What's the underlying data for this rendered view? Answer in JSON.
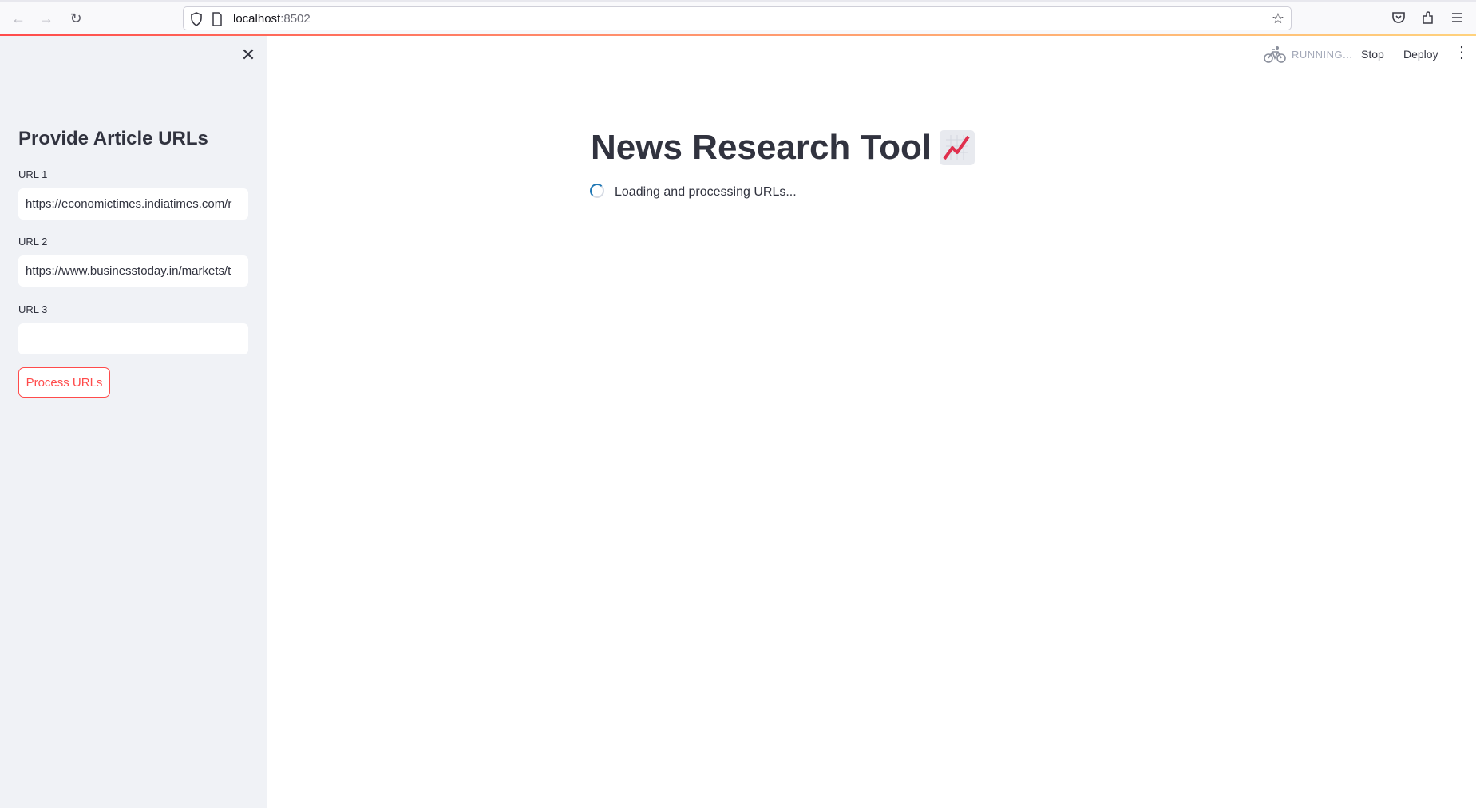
{
  "browser": {
    "url_host": "localhost",
    "url_port": ":8502"
  },
  "sidebar": {
    "title": "Provide Article URLs",
    "fields": [
      {
        "label": "URL 1",
        "value": "https://economictimes.indiatimes.com/r"
      },
      {
        "label": "URL 2",
        "value": "https://www.businesstoday.in/markets/t"
      },
      {
        "label": "URL 3",
        "value": ""
      }
    ],
    "process_button": "Process URLs"
  },
  "header": {
    "status": "RUNNING...",
    "stop": "Stop",
    "deploy": "Deploy"
  },
  "main": {
    "title": "News Research Tool",
    "title_icon": "chart-increasing-emoji",
    "loading_text": "Loading and processing URLs..."
  },
  "colors": {
    "accent": "#ff4b4b",
    "sidebar_bg": "#f0f2f6",
    "text": "#31333f"
  }
}
